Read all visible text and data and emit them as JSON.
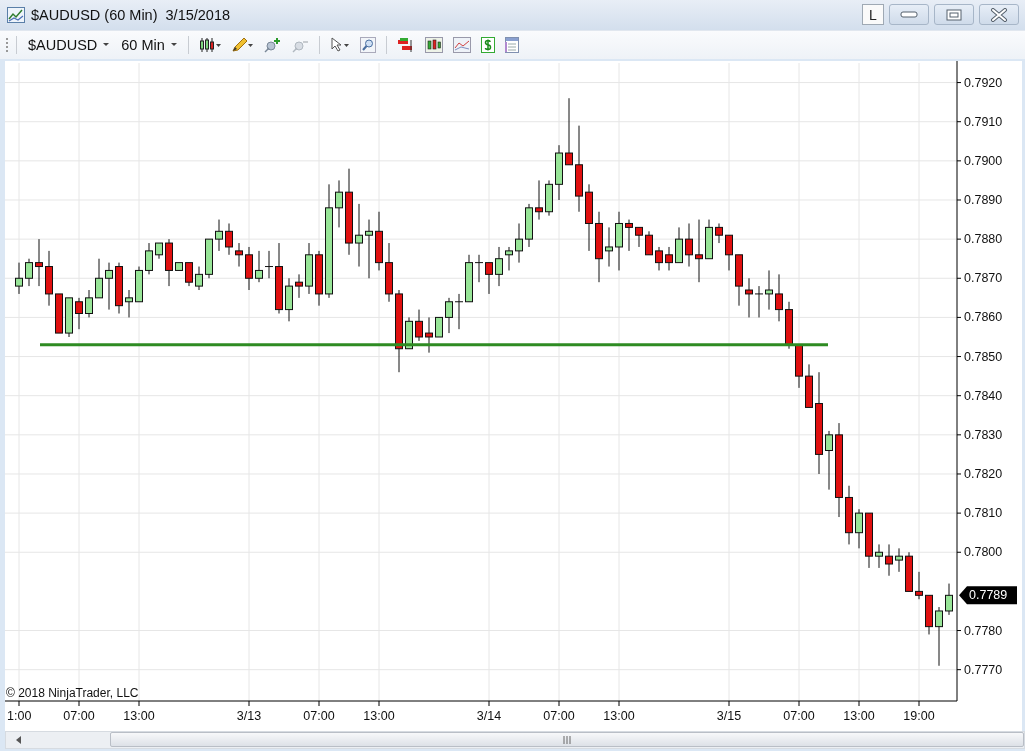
{
  "window": {
    "title": "$AUDUSD (60 Min)  3/15/2018",
    "buttons": [
      {
        "kind": "text",
        "label": "L"
      },
      {
        "kind": "minimize"
      },
      {
        "kind": "maximize"
      },
      {
        "kind": "close"
      }
    ]
  },
  "toolbar": {
    "instrument": "$AUDUSD",
    "interval": "60 Min"
  },
  "chart": {
    "copyright": "© 2018 NinjaTrader, LLC",
    "last_price": "0.7789",
    "chart_data": {
      "type": "candlestick",
      "grid": true,
      "ref_lines": [
        {
          "axis": "y",
          "value": 0.7853,
          "color": "#2e8b22"
        }
      ],
      "ylim": [
        0.7762,
        0.7925
      ],
      "yticks": [
        {
          "value": 0.792,
          "label": "0.7920"
        },
        {
          "value": 0.791,
          "label": "0.7910"
        },
        {
          "value": 0.79,
          "label": "0.7900"
        },
        {
          "value": 0.789,
          "label": "0.7890"
        },
        {
          "value": 0.788,
          "label": "0.7880"
        },
        {
          "value": 0.787,
          "label": "0.7870"
        },
        {
          "value": 0.786,
          "label": "0.7860"
        },
        {
          "value": 0.785,
          "label": "0.7850"
        },
        {
          "value": 0.784,
          "label": "0.7840"
        },
        {
          "value": 0.783,
          "label": "0.7830"
        },
        {
          "value": 0.782,
          "label": "0.7820"
        },
        {
          "value": 0.781,
          "label": "0.7810"
        },
        {
          "value": 0.78,
          "label": "0.7800"
        },
        {
          "value": 0.778,
          "label": "0.7780"
        },
        {
          "value": 0.777,
          "label": "0.7770"
        }
      ],
      "categories": [
        "1:00",
        null,
        null,
        null,
        null,
        null,
        "07:00",
        null,
        null,
        null,
        null,
        null,
        "13:00",
        null,
        null,
        null,
        null,
        null,
        null,
        null,
        null,
        null,
        null,
        "3/13",
        null,
        null,
        null,
        null,
        null,
        null,
        "07:00",
        null,
        null,
        null,
        null,
        null,
        "13:00",
        null,
        null,
        null,
        null,
        null,
        null,
        null,
        null,
        null,
        null,
        "3/14",
        null,
        null,
        null,
        null,
        null,
        null,
        "07:00",
        null,
        null,
        null,
        null,
        null,
        "13:00",
        null,
        null,
        null,
        null,
        null,
        null,
        null,
        null,
        null,
        null,
        "3/15",
        null,
        null,
        null,
        null,
        null,
        null,
        "07:00",
        null,
        null,
        null,
        null,
        null,
        "13:00",
        null,
        null,
        null,
        null,
        null,
        "19:00",
        null,
        null,
        null
      ],
      "ohlc": [
        [
          0.7868,
          0.7874,
          0.7866,
          0.787
        ],
        [
          0.787,
          0.7875,
          0.7868,
          0.7874
        ],
        [
          0.7874,
          0.788,
          0.7868,
          0.7873
        ],
        [
          0.7873,
          0.7877,
          0.7863,
          0.7866
        ],
        [
          0.7866,
          0.7866,
          0.7856,
          0.7856
        ],
        [
          0.7856,
          0.7865,
          0.7855,
          0.7865
        ],
        [
          0.7864,
          0.7865,
          0.7857,
          0.7861
        ],
        [
          0.7861,
          0.7867,
          0.786,
          0.7865
        ],
        [
          0.7865,
          0.7875,
          0.7865,
          0.787
        ],
        [
          0.787,
          0.7874,
          0.7862,
          0.7872
        ],
        [
          0.7873,
          0.7874,
          0.7861,
          0.7863
        ],
        [
          0.7864,
          0.7867,
          0.786,
          0.7865
        ],
        [
          0.7864,
          0.7873,
          0.7864,
          0.7872
        ],
        [
          0.7872,
          0.7879,
          0.7871,
          0.7877
        ],
        [
          0.7876,
          0.7879,
          0.7875,
          0.7879
        ],
        [
          0.7879,
          0.788,
          0.7868,
          0.7872
        ],
        [
          0.7872,
          0.7874,
          0.7872,
          0.7874
        ],
        [
          0.7874,
          0.7874,
          0.7868,
          0.7869
        ],
        [
          0.7868,
          0.7873,
          0.7867,
          0.7871
        ],
        [
          0.7871,
          0.788,
          0.787,
          0.788
        ],
        [
          0.788,
          0.7885,
          0.7877,
          0.7882
        ],
        [
          0.7882,
          0.7884,
          0.7876,
          0.7878
        ],
        [
          0.7877,
          0.7879,
          0.7873,
          0.7876
        ],
        [
          0.7876,
          0.7878,
          0.7867,
          0.787
        ],
        [
          0.787,
          0.7877,
          0.7869,
          0.7872
        ],
        [
          0.7873,
          0.7877,
          0.787,
          0.7873
        ],
        [
          0.7873,
          0.7879,
          0.7861,
          0.7862
        ],
        [
          0.7862,
          0.787,
          0.7859,
          0.7868
        ],
        [
          0.7869,
          0.7871,
          0.7865,
          0.7868
        ],
        [
          0.7868,
          0.7879,
          0.7866,
          0.7876
        ],
        [
          0.7876,
          0.7877,
          0.7863,
          0.7866
        ],
        [
          0.7866,
          0.7894,
          0.7865,
          0.7888
        ],
        [
          0.7888,
          0.7895,
          0.7883,
          0.7892
        ],
        [
          0.7892,
          0.7898,
          0.7876,
          0.7879
        ],
        [
          0.7879,
          0.7889,
          0.7873,
          0.7881
        ],
        [
          0.7881,
          0.7885,
          0.787,
          0.7882
        ],
        [
          0.7882,
          0.7887,
          0.7872,
          0.7874
        ],
        [
          0.7874,
          0.7879,
          0.7864,
          0.7866
        ],
        [
          0.7866,
          0.7867,
          0.7846,
          0.7852
        ],
        [
          0.7852,
          0.786,
          0.7852,
          0.7859
        ],
        [
          0.7859,
          0.7862,
          0.7854,
          0.7855
        ],
        [
          0.7856,
          0.786,
          0.7851,
          0.7855
        ],
        [
          0.7855,
          0.786,
          0.7855,
          0.786
        ],
        [
          0.786,
          0.7865,
          0.7856,
          0.7864
        ],
        [
          0.7864,
          0.7866,
          0.7857,
          0.7864
        ],
        [
          0.7864,
          0.7876,
          0.7864,
          0.7874
        ],
        [
          0.7874,
          0.7876,
          0.7869,
          0.7874
        ],
        [
          0.7874,
          0.7874,
          0.7866,
          0.7871
        ],
        [
          0.7871,
          0.7878,
          0.7868,
          0.7875
        ],
        [
          0.7876,
          0.7878,
          0.7872,
          0.7877
        ],
        [
          0.7877,
          0.7884,
          0.7874,
          0.788
        ],
        [
          0.788,
          0.7889,
          0.7878,
          0.7888
        ],
        [
          0.7888,
          0.7895,
          0.7885,
          0.7887
        ],
        [
          0.7887,
          0.7895,
          0.7886,
          0.7894
        ],
        [
          0.7894,
          0.7904,
          0.789,
          0.7902
        ],
        [
          0.7902,
          0.7916,
          0.7899,
          0.7899
        ],
        [
          0.7899,
          0.7909,
          0.7887,
          0.7891
        ],
        [
          0.7892,
          0.7894,
          0.7877,
          0.7884
        ],
        [
          0.7884,
          0.7887,
          0.7869,
          0.7875
        ],
        [
          0.7877,
          0.7883,
          0.7873,
          0.7878
        ],
        [
          0.7878,
          0.7887,
          0.7872,
          0.7884
        ],
        [
          0.7884,
          0.7885,
          0.7877,
          0.7883
        ],
        [
          0.7883,
          0.7883,
          0.7878,
          0.7881
        ],
        [
          0.7881,
          0.7882,
          0.7876,
          0.7876
        ],
        [
          0.7877,
          0.7878,
          0.7872,
          0.7874
        ],
        [
          0.7876,
          0.7878,
          0.7872,
          0.7874
        ],
        [
          0.7874,
          0.7883,
          0.7874,
          0.788
        ],
        [
          0.788,
          0.7884,
          0.7873,
          0.7876
        ],
        [
          0.7876,
          0.7885,
          0.7869,
          0.7875
        ],
        [
          0.7875,
          0.7885,
          0.7875,
          0.7883
        ],
        [
          0.7883,
          0.7884,
          0.7879,
          0.7881
        ],
        [
          0.7881,
          0.7881,
          0.7872,
          0.7876
        ],
        [
          0.7876,
          0.7876,
          0.7863,
          0.7868
        ],
        [
          0.7867,
          0.787,
          0.786,
          0.7866
        ],
        [
          0.7866,
          0.7868,
          0.786,
          0.7866
        ],
        [
          0.7866,
          0.7872,
          0.7862,
          0.7867
        ],
        [
          0.7866,
          0.7871,
          0.7859,
          0.7862
        ],
        [
          0.7862,
          0.7864,
          0.7852,
          0.7853
        ],
        [
          0.7853,
          0.7853,
          0.7842,
          0.7845
        ],
        [
          0.7845,
          0.7848,
          0.7837,
          0.7837
        ],
        [
          0.7838,
          0.7846,
          0.782,
          0.7825
        ],
        [
          0.7826,
          0.7831,
          0.7816,
          0.783
        ],
        [
          0.783,
          0.7833,
          0.7809,
          0.7814
        ],
        [
          0.7814,
          0.7817,
          0.7802,
          0.7805
        ],
        [
          0.7805,
          0.7811,
          0.7801,
          0.781
        ],
        [
          0.781,
          0.781,
          0.7796,
          0.7799
        ],
        [
          0.7799,
          0.7802,
          0.7796,
          0.78
        ],
        [
          0.7799,
          0.7802,
          0.7794,
          0.7797
        ],
        [
          0.7798,
          0.7801,
          0.7795,
          0.7799
        ],
        [
          0.7799,
          0.78,
          0.779,
          0.779
        ],
        [
          0.779,
          0.7795,
          0.7788,
          0.7789
        ],
        [
          0.7789,
          0.7789,
          0.7779,
          0.7781
        ],
        [
          0.7781,
          0.7786,
          0.7771,
          0.7785
        ],
        [
          0.7785,
          0.7792,
          0.7784,
          0.7789
        ]
      ]
    }
  }
}
